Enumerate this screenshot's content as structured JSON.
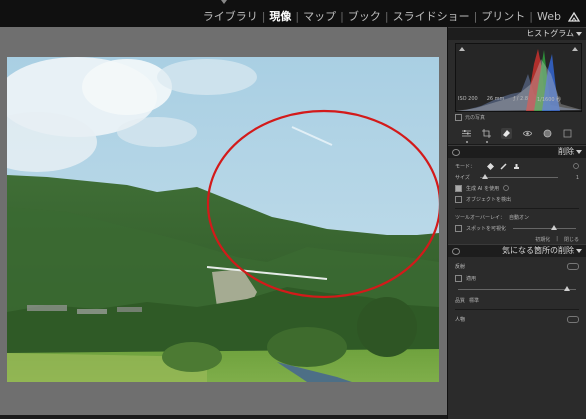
{
  "modules": {
    "items": [
      {
        "label": "ライブラリ",
        "active": false
      },
      {
        "label": "現像",
        "active": true
      },
      {
        "label": "マップ",
        "active": false
      },
      {
        "label": "ブック",
        "active": false
      },
      {
        "label": "スライドショー",
        "active": false
      },
      {
        "label": "プリント",
        "active": false
      },
      {
        "label": "Web",
        "active": false
      }
    ],
    "separator": "|",
    "cloud_icon": "cloud-sync-icon"
  },
  "histogram": {
    "title": "ヒストグラム",
    "exif": {
      "iso": "ISO 200",
      "focal": "26 mm",
      "aperture": "ƒ / 2.8",
      "shutter": "1/1600 秒"
    },
    "original_label": "元の写真"
  },
  "toolstrip": {
    "tools": [
      "edit-sliders-icon",
      "crop-icon",
      "eraser-icon",
      "redeye-icon",
      "mask-icon",
      "presets-icon"
    ]
  },
  "remove_panel": {
    "title": "削除",
    "mode_label": "モード：",
    "size_label": "サイズ",
    "size_value": "1",
    "use_ai_label": "生成 AI を使用",
    "detect_objects_label": "オブジェクトを検出",
    "tool_overlay_label": "ツールオーバーレイ：",
    "tool_overlay_value": "自動オン",
    "visualize_spots_label": "スポットを可視化",
    "reset_label": "初期化",
    "close_label": "閉じる"
  },
  "distraction_panel": {
    "title": "気になる箇所の削除",
    "reflection_label": "反射",
    "apply_label": "適用",
    "quality_label": "品質",
    "quality_value": "標準",
    "people_label": "人物"
  },
  "colors": {
    "accent_red_ellipse": "#d31a1a",
    "panel_bg": "#2b2b2b",
    "topbar_bg": "#101010"
  }
}
